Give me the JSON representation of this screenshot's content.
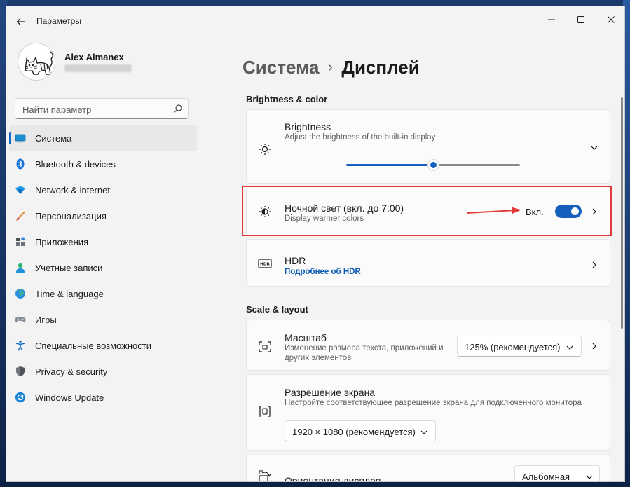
{
  "window": {
    "title": "Параметры"
  },
  "profile": {
    "name": "Alex Almanex"
  },
  "search": {
    "placeholder": "Найти параметр"
  },
  "sidebar": {
    "items": [
      {
        "label": "Система",
        "icon": "system-icon",
        "active": true
      },
      {
        "label": "Bluetooth & devices",
        "icon": "bluetooth-icon"
      },
      {
        "label": "Network & internet",
        "icon": "wifi-icon"
      },
      {
        "label": "Персонализация",
        "icon": "brush-icon"
      },
      {
        "label": "Приложения",
        "icon": "apps-icon"
      },
      {
        "label": "Учетные записи",
        "icon": "person-icon"
      },
      {
        "label": "Time & language",
        "icon": "globe-icon"
      },
      {
        "label": "Игры",
        "icon": "gamepad-icon"
      },
      {
        "label": "Специальные возможности",
        "icon": "accessibility-icon"
      },
      {
        "label": "Privacy & security",
        "icon": "shield-icon"
      },
      {
        "label": "Windows Update",
        "icon": "update-icon"
      }
    ]
  },
  "breadcrumb": {
    "parent": "Система",
    "separator": "›",
    "current": "Дисплей"
  },
  "sections": {
    "brightness_color": "Brightness & color",
    "scale_layout": "Scale & layout"
  },
  "brightness": {
    "title": "Brightness",
    "subtitle": "Adjust the brightness of the built-in display",
    "level": 0.5
  },
  "night_light": {
    "title": "Ночной свет (вкл. до 7:00)",
    "subtitle": "Display warmer colors",
    "state_label": "Вкл.",
    "on": true
  },
  "hdr": {
    "title": "HDR",
    "link": "Подробнее об HDR"
  },
  "scale": {
    "title": "Масштаб",
    "subtitle_line1": "Изменение размера текста, приложений и",
    "subtitle_line2": "других элементов",
    "value": "125% (рекомендуется)"
  },
  "resolution": {
    "title": "Разрешение экрана",
    "subtitle": "Настройте соответствующее разрешение экрана для подключенного монитора",
    "value": "1920 × 1080 (рекомендуется)"
  },
  "orientation": {
    "title": "Ориентация дисплея",
    "value": "Альбомная"
  },
  "colors": {
    "accent": "#1560bd",
    "highlight_box": "#e23b3b",
    "annotation_arrow": "#e23b3b"
  }
}
